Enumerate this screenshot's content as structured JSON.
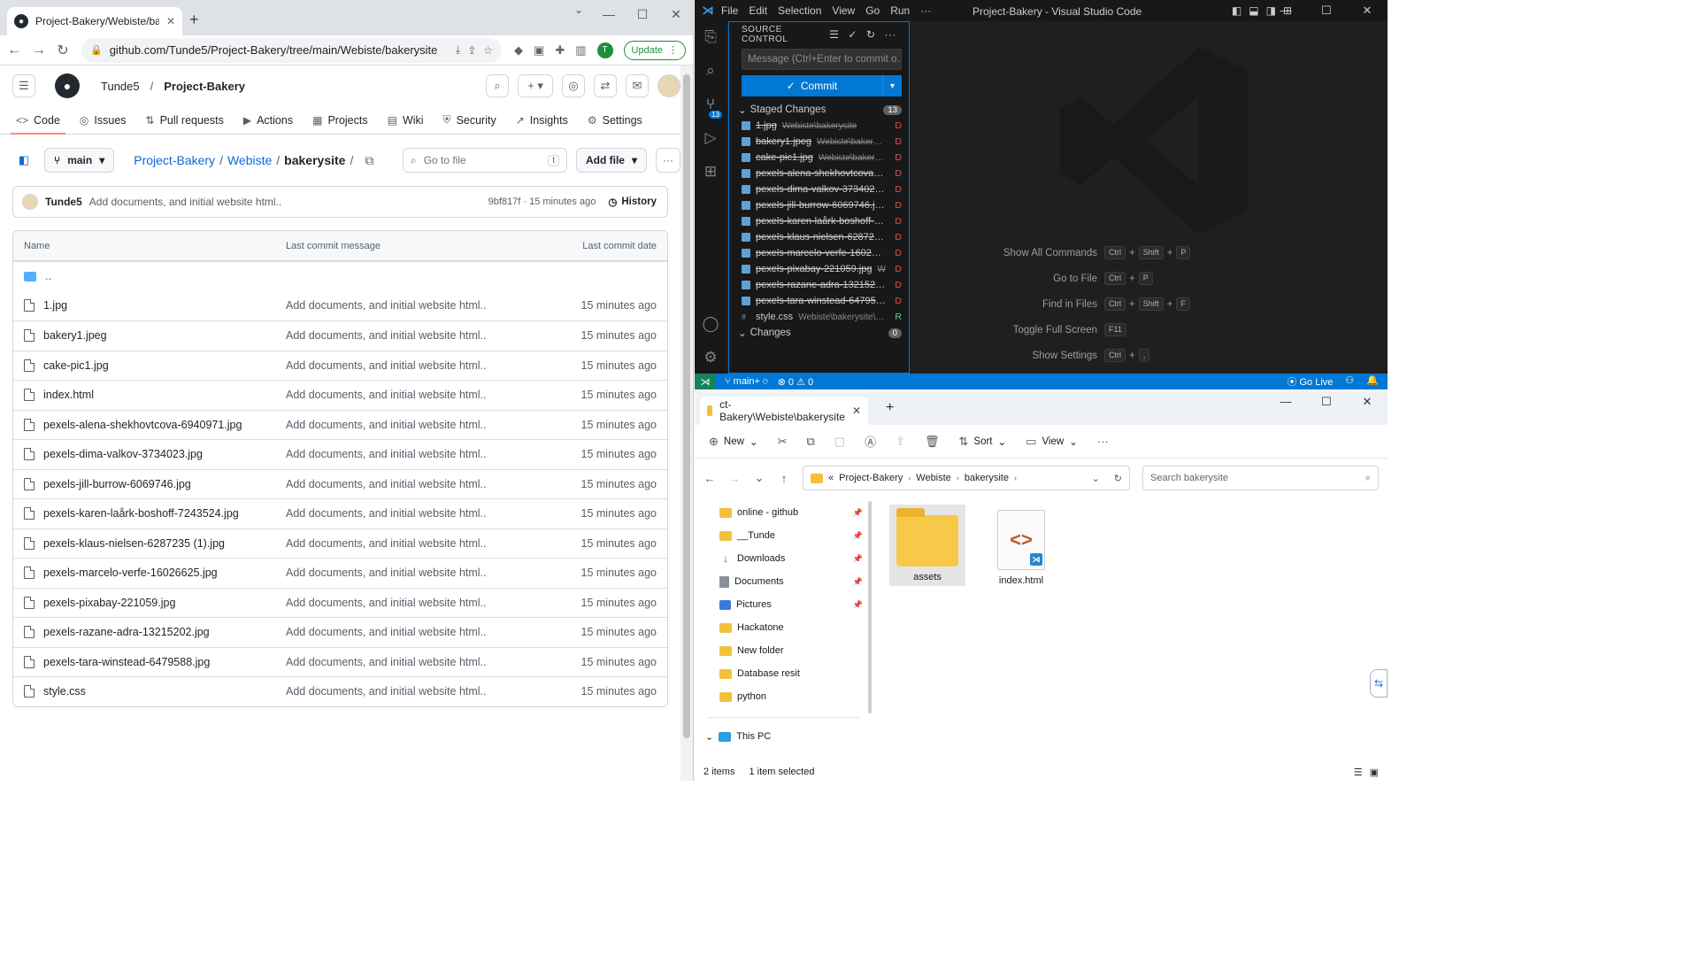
{
  "browser": {
    "tab_title": "Project-Bakery/Webiste/bakerysite",
    "url": "github.com/Tunde5/Project-Bakery/tree/main/Webiste/bakerysite",
    "avatar_letter": "T",
    "update_label": "Update"
  },
  "github": {
    "owner": "Tunde5",
    "repo": "Project-Bakery",
    "tabs": [
      "Code",
      "Issues",
      "Pull requests",
      "Actions",
      "Projects",
      "Wiki",
      "Security",
      "Insights",
      "Settings"
    ],
    "branch": "main",
    "crumbs": [
      "Project-Bakery",
      "Webiste",
      "bakerysite"
    ],
    "goto_placeholder": "Go to file",
    "goto_key": "t",
    "add_file_label": "Add file",
    "commit": {
      "user": "Tunde5",
      "message": "Add documents, and initial website html..",
      "meta": "9bf817f · 15 minutes ago",
      "history_label": "History"
    },
    "table_headers": {
      "name": "Name",
      "message": "Last commit message",
      "date": "Last commit date"
    },
    "parent_dir": "..",
    "files": [
      {
        "name": "1.jpg",
        "msg": "Add documents, and initial website html..",
        "date": "15 minutes ago"
      },
      {
        "name": "bakery1.jpeg",
        "msg": "Add documents, and initial website html..",
        "date": "15 minutes ago"
      },
      {
        "name": "cake-pic1.jpg",
        "msg": "Add documents, and initial website html..",
        "date": "15 minutes ago"
      },
      {
        "name": "index.html",
        "msg": "Add documents, and initial website html..",
        "date": "15 minutes ago"
      },
      {
        "name": "pexels-alena-shekhovtcova-6940971.jpg",
        "msg": "Add documents, and initial website html..",
        "date": "15 minutes ago"
      },
      {
        "name": "pexels-dima-valkov-3734023.jpg",
        "msg": "Add documents, and initial website html..",
        "date": "15 minutes ago"
      },
      {
        "name": "pexels-jill-burrow-6069746.jpg",
        "msg": "Add documents, and initial website html..",
        "date": "15 minutes ago"
      },
      {
        "name": "pexels-karen-laårk-boshoff-7243524.jpg",
        "msg": "Add documents, and initial website html..",
        "date": "15 minutes ago"
      },
      {
        "name": "pexels-klaus-nielsen-6287235 (1).jpg",
        "msg": "Add documents, and initial website html..",
        "date": "15 minutes ago"
      },
      {
        "name": "pexels-marcelo-verfe-16026625.jpg",
        "msg": "Add documents, and initial website html..",
        "date": "15 minutes ago"
      },
      {
        "name": "pexels-pixabay-221059.jpg",
        "msg": "Add documents, and initial website html..",
        "date": "15 minutes ago"
      },
      {
        "name": "pexels-razane-adra-13215202.jpg",
        "msg": "Add documents, and initial website html..",
        "date": "15 minutes ago"
      },
      {
        "name": "pexels-tara-winstead-6479588.jpg",
        "msg": "Add documents, and initial website html..",
        "date": "15 minutes ago"
      },
      {
        "name": "style.css",
        "msg": "Add documents, and initial website html..",
        "date": "15 minutes ago"
      }
    ]
  },
  "vscode": {
    "menu": [
      "File",
      "Edit",
      "Selection",
      "View",
      "Go",
      "Run",
      "···"
    ],
    "title": "Project-Bakery - Visual Studio Code",
    "panel_title": "SOURCE CONTROL",
    "scm_badge": "13",
    "message_placeholder": "Message (Ctrl+Enter to commit o...",
    "commit_label": "Commit",
    "staged_label": "Staged Changes",
    "staged_count": "13",
    "changes_label": "Changes",
    "changes_count": "0",
    "staged": [
      {
        "name": "1.jpg",
        "path": "Webiste\\bakerysite",
        "status": "D"
      },
      {
        "name": "bakery1.jpeg",
        "path": "Webiste\\bakerysite",
        "status": "D"
      },
      {
        "name": "cake-pic1.jpg",
        "path": "Webiste\\bakerysite",
        "status": "D"
      },
      {
        "name": "pexels-alena-shekhovtcova-69...",
        "path": "",
        "status": "D"
      },
      {
        "name": "pexels-dima-valkov-3734023.j...",
        "path": "",
        "status": "D"
      },
      {
        "name": "pexels-jill-burrow-6069746.jpg...",
        "path": "",
        "status": "D"
      },
      {
        "name": "pexels-karen-laårk-boshoff-72...",
        "path": "",
        "status": "D"
      },
      {
        "name": "pexels-klaus-nielsen-6287235-...",
        "path": "",
        "status": "D"
      },
      {
        "name": "pexels-marcelo-verfe-1602662...",
        "path": "",
        "status": "D"
      },
      {
        "name": "pexels-pixabay-221059.jpg",
        "path": "We...",
        "status": "D"
      },
      {
        "name": "pexels-razane-adra-13215202....",
        "path": "",
        "status": "D"
      },
      {
        "name": "pexels-tara-winstead-6479588...",
        "path": "",
        "status": "D"
      },
      {
        "name": "style.css",
        "path": "Webiste\\bakerysite\\asse...",
        "status": "R"
      }
    ],
    "shortcuts": [
      {
        "label": "Show All Commands",
        "keys": [
          "Ctrl",
          "+",
          "Shift",
          "+",
          "P"
        ]
      },
      {
        "label": "Go to File",
        "keys": [
          "Ctrl",
          "+",
          "P"
        ]
      },
      {
        "label": "Find in Files",
        "keys": [
          "Ctrl",
          "+",
          "Shift",
          "+",
          "F"
        ]
      },
      {
        "label": "Toggle Full Screen",
        "keys": [
          "F11"
        ]
      },
      {
        "label": "Show Settings",
        "keys": [
          "Ctrl",
          "+",
          ","
        ]
      }
    ],
    "status": {
      "branch": "main+",
      "errors": "0",
      "warnings": "0",
      "golive": "Go Live"
    }
  },
  "explorer": {
    "tab_title": "ct-Bakery\\Webiste\\bakerysite",
    "cmd": {
      "new": "New",
      "sort": "Sort",
      "view": "View"
    },
    "address": [
      "Project-Bakery",
      "Webiste",
      "bakerysite"
    ],
    "address_prefix": "«",
    "search_placeholder": "Search bakerysite",
    "nav": [
      {
        "label": "online - github",
        "pinned": true,
        "kind": "folder"
      },
      {
        "label": "__Tunde",
        "pinned": true,
        "kind": "folder"
      },
      {
        "label": "Downloads",
        "pinned": true,
        "kind": "download"
      },
      {
        "label": "Documents",
        "pinned": true,
        "kind": "doc"
      },
      {
        "label": "Pictures",
        "pinned": true,
        "kind": "pic"
      },
      {
        "label": "Hackatone",
        "pinned": false,
        "kind": "folder"
      },
      {
        "label": "New folder",
        "pinned": false,
        "kind": "folder"
      },
      {
        "label": "Database resit",
        "pinned": false,
        "kind": "folder"
      },
      {
        "label": "python",
        "pinned": false,
        "kind": "folder"
      }
    ],
    "this_pc": "This PC",
    "items": [
      {
        "name": "assets",
        "kind": "folder",
        "selected": true
      },
      {
        "name": "index.html",
        "kind": "html",
        "selected": false
      }
    ],
    "status_count": "2 items",
    "status_selected": "1 item selected"
  }
}
